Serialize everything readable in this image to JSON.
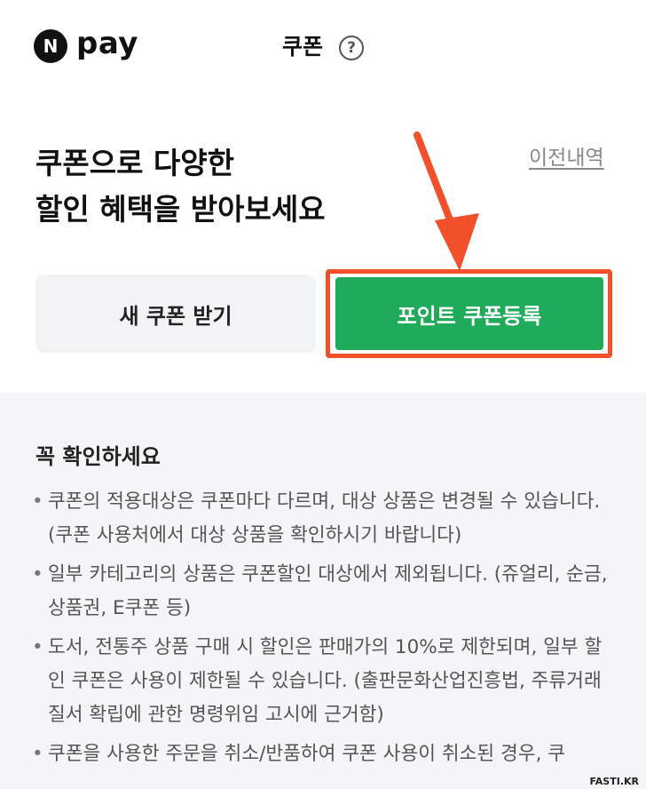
{
  "header": {
    "logo_badge": "N",
    "logo_text": "pay",
    "title": "쿠폰",
    "help_symbol": "?"
  },
  "hero": {
    "title_line1": "쿠폰으로 다양한",
    "title_line2": "할인 혜택을 받아보세요",
    "history_link": "이전내역"
  },
  "actions": {
    "new_coupon_label": "새 쿠폰 받기",
    "register_label": "포인트 쿠폰등록"
  },
  "notice": {
    "title": "꼭 확인하세요",
    "items": [
      {
        "bullet": "•",
        "text": "쿠폰의 적용대상은 쿠폰마다 다르며, 대상 상품은 변경될 수 있습니다. (쿠폰 사용처에서 대상 상품을 확인하시기 바랍니다)"
      },
      {
        "bullet": "•",
        "text": "일부 카테고리의 상품은 쿠폰할인 대상에서 제외됩니다. (쥬얼리, 순금, 상품권, E쿠폰 등)"
      },
      {
        "bullet": "•",
        "text": "도서, 전통주 상품 구매 시 할인은 판매가의 10%로 제한되며, 일부 할인 쿠폰은 사용이 제한될 수 있습니다. (출판문화산업진흥법, 주류거래질서 확립에 관한 명령위임 고시에 근거함)"
      },
      {
        "bullet": "•",
        "text": "쿠폰을 사용한 주문을 취소/반품하여 쿠폰 사용이 취소된 경우, 쿠"
      }
    ]
  },
  "colors": {
    "register_green": "#20ab5a",
    "highlight_orange": "#f2502a"
  },
  "watermark": "FASTI.KR"
}
